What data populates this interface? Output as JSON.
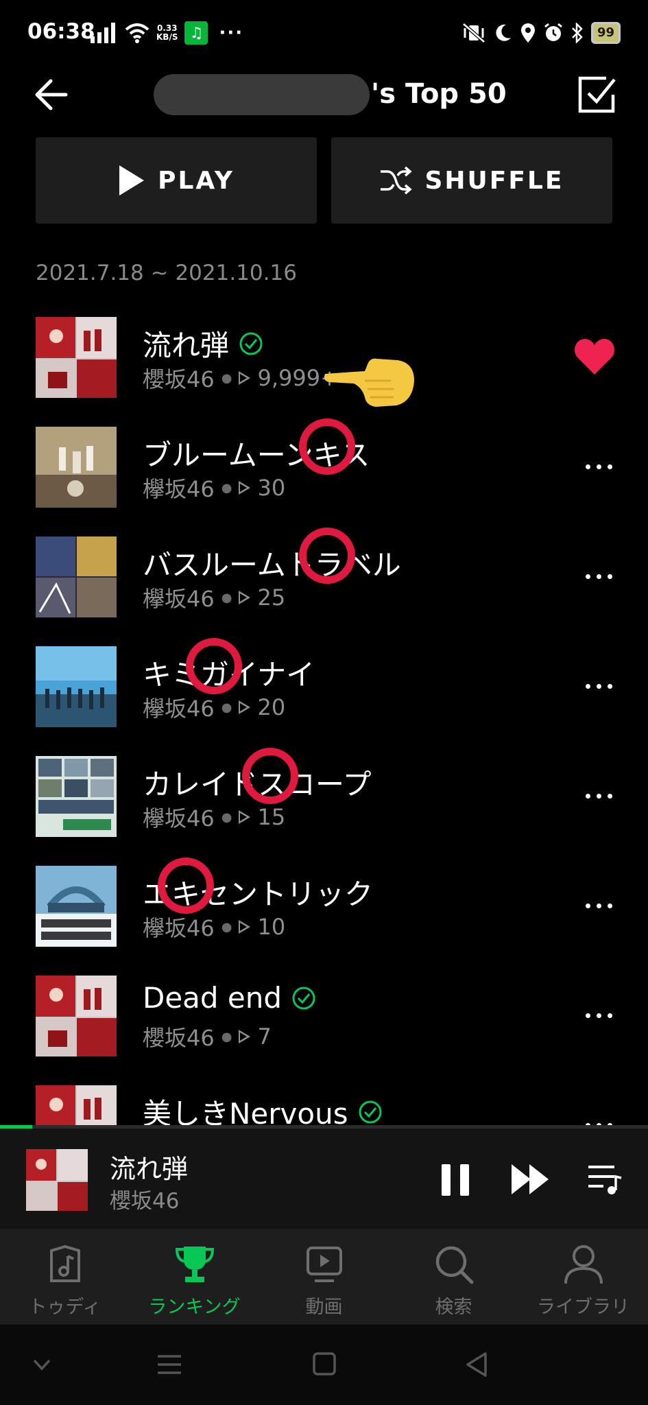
{
  "status_bar": {
    "time": "06:38",
    "net_speed_top": "0.33",
    "net_speed_bottom": "KB/S",
    "battery": "99"
  },
  "header": {
    "title": "'s Top 50"
  },
  "actions": {
    "play_label": "PLAY",
    "shuffle_label": "SHUFFLE"
  },
  "date_range": "2021.7.18 ~ 2021.10.16",
  "tracks": [
    {
      "title": "流れ弾",
      "artist": "櫻坂46",
      "plays": "9,999+",
      "verified": true,
      "liked": true
    },
    {
      "title": "ブルームーンキス",
      "artist": "欅坂46",
      "plays": "30",
      "verified": false
    },
    {
      "title": "バスルームトラベル",
      "artist": "欅坂46",
      "plays": "25",
      "verified": false
    },
    {
      "title": "キミガイナイ",
      "artist": "欅坂46",
      "plays": "20",
      "verified": false
    },
    {
      "title": "カレイドスコープ",
      "artist": "欅坂46",
      "plays": "15",
      "verified": false
    },
    {
      "title": "エキセントリック",
      "artist": "欅坂46",
      "plays": "10",
      "verified": false
    },
    {
      "title": "Dead end",
      "artist": "櫻坂46",
      "plays": "7",
      "verified": true
    },
    {
      "title": "美しきNervous",
      "artist": "",
      "plays": "",
      "verified": true
    }
  ],
  "now_playing": {
    "title": "流れ弾",
    "artist": "櫻坂46",
    "progress": 0.05
  },
  "tabs": [
    {
      "label": "トゥディ",
      "icon": "music-note-icon",
      "active": false
    },
    {
      "label": "ランキング",
      "icon": "trophy-icon",
      "active": true
    },
    {
      "label": "動画",
      "icon": "video-icon",
      "active": false
    },
    {
      "label": "検索",
      "icon": "search-icon",
      "active": false
    },
    {
      "label": "ライブラリ",
      "icon": "person-icon",
      "active": false
    }
  ],
  "colors": {
    "accent": "#07c755",
    "heart": "#f0224f",
    "annotation": "#e0193e",
    "pointer_hand": "#f5c842"
  }
}
